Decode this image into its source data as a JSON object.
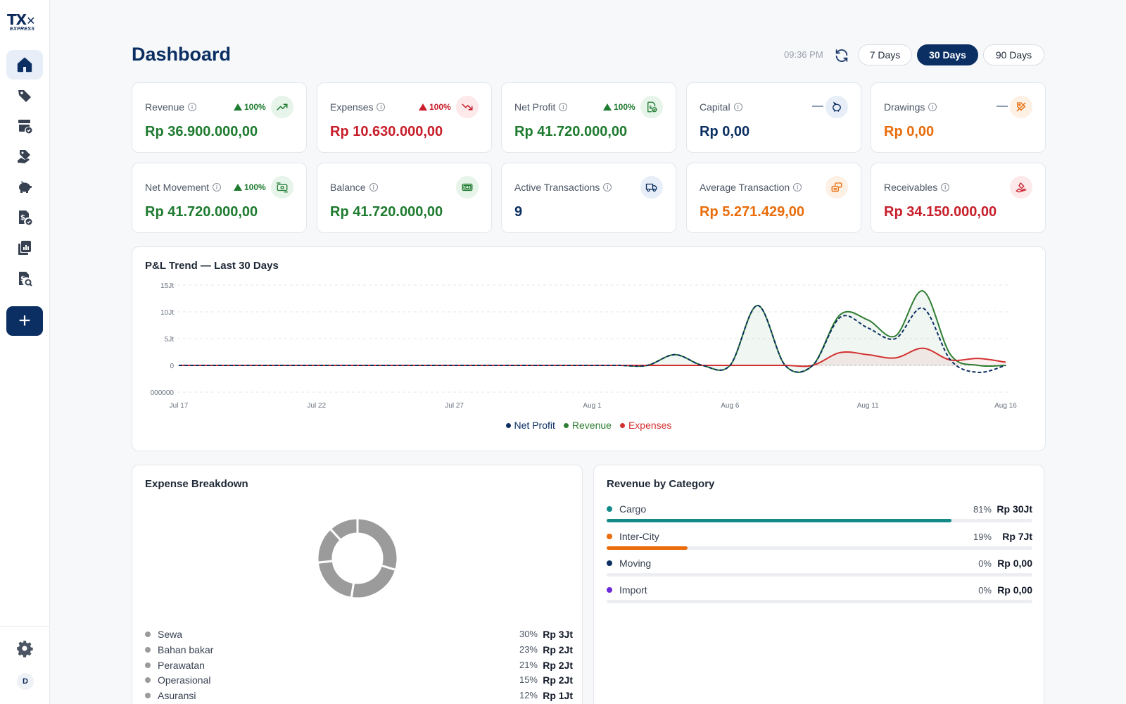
{
  "app": {
    "logo_main": "TX",
    "logo_sub": "EXPRESS"
  },
  "sidebar": {
    "items": [
      {
        "icon": "home-icon",
        "active": true
      },
      {
        "icon": "tag-icon"
      },
      {
        "icon": "inventory-check-icon"
      },
      {
        "icon": "discount-hand-icon"
      },
      {
        "icon": "piggy-bank-icon"
      },
      {
        "icon": "invoice-check-icon"
      },
      {
        "icon": "reports-icon"
      },
      {
        "icon": "audit-search-icon"
      }
    ],
    "add_label": "+",
    "avatar": "D"
  },
  "header": {
    "title": "Dashboard",
    "time": "09:36 PM",
    "ranges": [
      "7 Days",
      "30 Days",
      "90 Days"
    ],
    "active_range": "30 Days"
  },
  "kpis": [
    {
      "label": "Revenue",
      "value": "Rp 36.900.000,00",
      "trend": "100%",
      "trend_dir": "up",
      "value_color": "#1e7b2f",
      "icon": "trend-up-icon",
      "icon_color": "#1e7b2f",
      "icon_bg": "#e7f4ea"
    },
    {
      "label": "Expenses",
      "value": "Rp 10.630.000,00",
      "trend": "100%",
      "trend_dir": "up",
      "value_color": "#c81e2b",
      "icon": "trend-down-icon",
      "icon_color": "#c81e2b",
      "icon_bg": "#fde8ea"
    },
    {
      "label": "Net Profit",
      "value": "Rp 41.720.000,00",
      "trend": "100%",
      "trend_dir": "up",
      "value_color": "#1e7b2f",
      "icon": "money-file-icon",
      "icon_color": "#1e7b2f",
      "icon_bg": "#e7f4ea"
    },
    {
      "label": "Capital",
      "value": "Rp 0,00",
      "trend": "—",
      "trend_dir": "flat",
      "value_color": "#0b2f63",
      "icon": "piggy-bank-icon",
      "icon_color": "#0b2f63",
      "icon_bg": "#e8eef7"
    },
    {
      "label": "Drawings",
      "value": "Rp 0,00",
      "trend": "—",
      "trend_dir": "flat",
      "value_color": "#ea6c0a",
      "icon": "hand-discount-icon",
      "icon_color": "#ea6c0a",
      "icon_bg": "#fdf0e4"
    },
    {
      "label": "Net Movement",
      "value": "Rp 41.720.000,00",
      "trend": "100%",
      "trend_dir": "up",
      "value_color": "#1e7b2f",
      "icon": "cash-flow-icon",
      "icon_color": "#1e7b2f",
      "icon_bg": "#e7f4ea"
    },
    {
      "label": "Balance",
      "value": "Rp 41.720.000,00",
      "trend": "",
      "trend_dir": "none",
      "value_color": "#1e7b2f",
      "icon": "banknote-icon",
      "icon_color": "#1e7b2f",
      "icon_bg": "#e7f4ea"
    },
    {
      "label": "Active Transactions",
      "value": "9",
      "trend": "",
      "trend_dir": "none",
      "value_color": "#0b2f63",
      "icon": "truck-icon",
      "icon_color": "#0b2f63",
      "icon_bg": "#e8eef7"
    },
    {
      "label": "Average Transaction",
      "value": "Rp 5.271.429,00",
      "trend": "",
      "trend_dir": "none",
      "value_color": "#ea6c0a",
      "icon": "coins-icon",
      "icon_color": "#ea6c0a",
      "icon_bg": "#fdf0e4"
    },
    {
      "label": "Receivables",
      "value": "Rp 34.150.000,00",
      "trend": "",
      "trend_dir": "none",
      "value_color": "#c81e2b",
      "icon": "hand-money-icon",
      "icon_color": "#c81e2b",
      "icon_bg": "#fde8ea"
    }
  ],
  "colors": {
    "primary": "#0b2f63",
    "green": "#2e7d32",
    "red": "#d32f2f",
    "orange": "#ea6c0a",
    "teal": "#138a8a",
    "purple": "#6d28d9",
    "grey": "#9b9b9b"
  },
  "chart_data": {
    "type": "line",
    "title": "P&L Trend — Last 30 Days",
    "x": [
      "Jul 17",
      "Jul 18",
      "Jul 19",
      "Jul 20",
      "Jul 21",
      "Jul 22",
      "Jul 23",
      "Jul 24",
      "Jul 25",
      "Jul 26",
      "Jul 27",
      "Jul 28",
      "Jul 29",
      "Jul 30",
      "Jul 31",
      "Aug 1",
      "Aug 2",
      "Aug 3",
      "Aug 4",
      "Aug 5",
      "Aug 6",
      "Aug 7",
      "Aug 8",
      "Aug 9",
      "Aug 10",
      "Aug 11",
      "Aug 12",
      "Aug 13",
      "Aug 14",
      "Aug 15",
      "Aug 16"
    ],
    "x_ticks": [
      "Jul 17",
      "Jul 22",
      "Jul 27",
      "Aug 1",
      "Aug 6",
      "Aug 11",
      "Aug 16"
    ],
    "y_ticks": [
      15000000,
      10000000,
      5000000,
      0,
      -5000000
    ],
    "y_tick_labels": [
      "15Jt",
      "10Jt",
      "5Jt",
      "0",
      "000000"
    ],
    "ylim": [
      -5000000,
      15000000
    ],
    "series": [
      {
        "name": "Net Profit",
        "color": "#0b2f63",
        "dashed": true,
        "values": [
          0,
          0,
          0,
          0,
          0,
          0,
          0,
          0,
          0,
          0,
          0,
          0,
          0,
          0,
          0,
          0,
          0,
          0,
          2000000,
          0,
          0,
          11200000,
          0,
          0,
          9000000,
          7000000,
          5000000,
          10700000,
          1000000,
          -1300000,
          0
        ]
      },
      {
        "name": "Revenue",
        "color": "#2e7d32",
        "dashed": false,
        "values": [
          0,
          0,
          0,
          0,
          0,
          0,
          0,
          0,
          0,
          0,
          0,
          0,
          0,
          0,
          0,
          0,
          0,
          0,
          2000000,
          0,
          0,
          11200000,
          0,
          0,
          9500000,
          8500000,
          5500000,
          13900000,
          2000000,
          0,
          0
        ]
      },
      {
        "name": "Expenses",
        "color": "#d32f2f",
        "dashed": false,
        "values": [
          0,
          0,
          0,
          0,
          0,
          0,
          0,
          0,
          0,
          0,
          0,
          0,
          0,
          0,
          0,
          0,
          0,
          0,
          0,
          0,
          0,
          0,
          0,
          0,
          2400000,
          2000000,
          1400000,
          3200000,
          1000000,
          1300000,
          600000
        ]
      }
    ],
    "grid": true,
    "legend": "bottom-center"
  },
  "expense_breakdown": {
    "title": "Expense Breakdown",
    "items": [
      {
        "name": "Sewa",
        "pct": "30%",
        "amount": "Rp 3Jt",
        "value": 30
      },
      {
        "name": "Bahan bakar",
        "pct": "23%",
        "amount": "Rp 2Jt",
        "value": 23
      },
      {
        "name": "Perawatan",
        "pct": "21%",
        "amount": "Rp 2Jt",
        "value": 21
      },
      {
        "name": "Operasional",
        "pct": "15%",
        "amount": "Rp 2Jt",
        "value": 15
      },
      {
        "name": "Asuransi",
        "pct": "12%",
        "amount": "Rp 1Jt",
        "value": 12
      }
    ]
  },
  "revenue_by_category": {
    "title": "Revenue by Category",
    "items": [
      {
        "name": "Cargo",
        "pct": "81%",
        "amount": "Rp 30Jt",
        "fill": 0.81,
        "color": "#138a8a"
      },
      {
        "name": "Inter-City",
        "pct": "19%",
        "amount": "Rp 7Jt",
        "fill": 0.19,
        "color": "#ea6c0a"
      },
      {
        "name": "Moving",
        "pct": "0%",
        "amount": "Rp 0,00",
        "fill": 0,
        "color": "#0b2f63"
      },
      {
        "name": "Import",
        "pct": "0%",
        "amount": "Rp 0,00",
        "fill": 0,
        "color": "#6d28d9"
      }
    ]
  }
}
